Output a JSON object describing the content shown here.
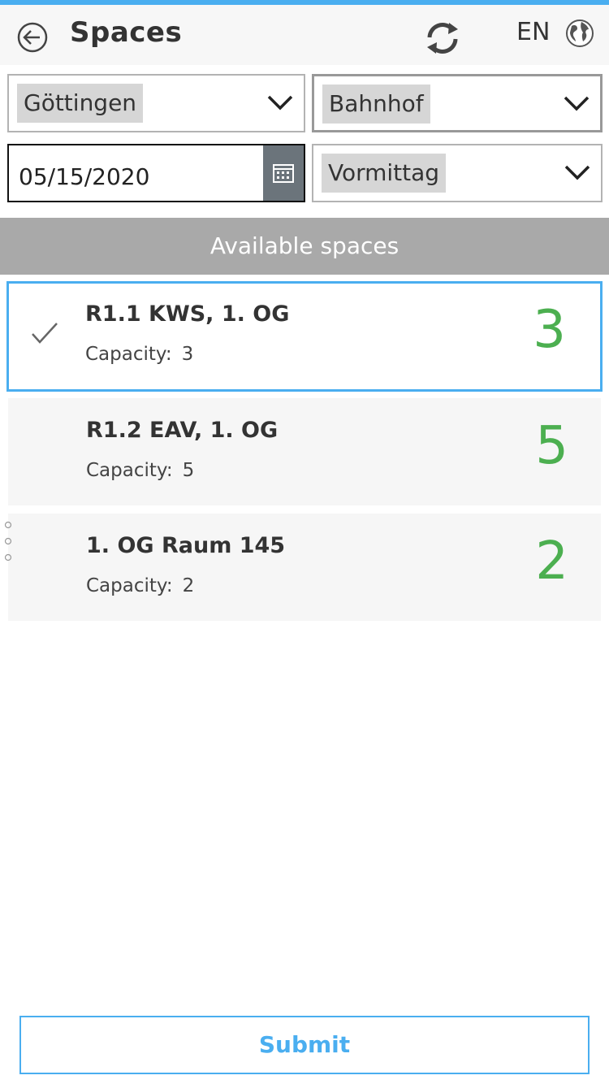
{
  "header": {
    "title": "Spaces",
    "language": "EN",
    "accent_color": "#4aaef0"
  },
  "filters": {
    "city": "Göttingen",
    "location": "Bahnhof",
    "date": "05/15/2020",
    "time_slot": "Vormittag"
  },
  "section": {
    "title": "Available spaces"
  },
  "spaces": [
    {
      "name": "R1.1 KWS, 1. OG",
      "capacity_label": "Capacity:",
      "capacity": "3",
      "available": "3",
      "selected": true
    },
    {
      "name": "R1.2 EAV, 1. OG",
      "capacity_label": "Capacity:",
      "capacity": "5",
      "available": "5",
      "selected": false
    },
    {
      "name": "1. OG Raum 145",
      "capacity_label": "Capacity:",
      "capacity": "2",
      "available": "2",
      "selected": false
    }
  ],
  "actions": {
    "submit_label": "Submit"
  },
  "icons": [
    "back-arrow-icon",
    "refresh-icon",
    "globe-icon",
    "chevron-down-icon",
    "calendar-icon",
    "checkmark-icon"
  ]
}
